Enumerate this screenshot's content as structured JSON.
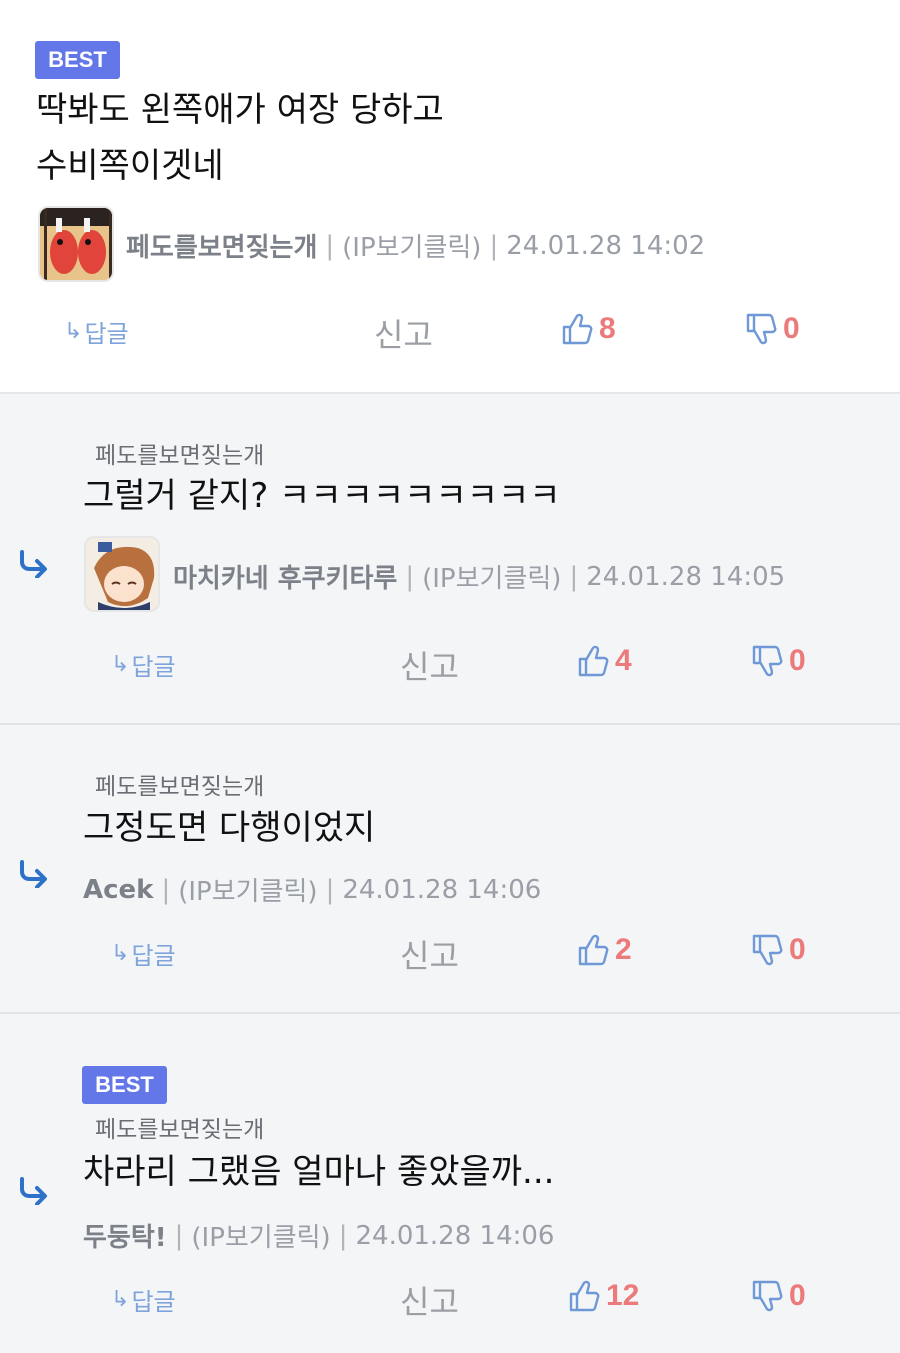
{
  "comments": [
    {
      "badge": "BEST",
      "text_lines": [
        "딱봐도 왼쪽애가 여장 당하고",
        "수비쪽이겟네"
      ],
      "nick": "페도를보면짖는개",
      "ip": "(IP보기클릭)",
      "date": "24.01.28 14:02",
      "reply_label": "답글",
      "report_label": "신고",
      "likes": "8",
      "dislikes": "0"
    },
    {
      "reply_to": "페도를보면짖는개",
      "text": "그럴거 같지? ㅋㅋㅋㅋㅋㅋㅋㅋㅋ",
      "nick": "마치카네 후쿠키타루",
      "ip": "(IP보기클릭)",
      "date": "24.01.28 14:05",
      "reply_label": "답글",
      "report_label": "신고",
      "likes": "4",
      "dislikes": "0"
    },
    {
      "reply_to": "페도를보면짖는개",
      "text": "그정도면 다행이었지",
      "nick": "Acek",
      "ip": "(IP보기클릭)",
      "date": "24.01.28 14:06",
      "reply_label": "답글",
      "report_label": "신고",
      "likes": "2",
      "dislikes": "0"
    },
    {
      "badge": "BEST",
      "reply_to": "페도를보면짖는개",
      "text": "차라리 그랬음 얼마나 좋았을까...",
      "nick": "두둥탁!",
      "ip": "(IP보기클릭)",
      "date": "24.01.28 14:06",
      "reply_label": "답글",
      "report_label": "신고",
      "likes": "12",
      "dislikes": "0"
    }
  ],
  "icons": {
    "reply": "reply-arrow-icon",
    "like": "thumbs-up-icon",
    "dislike": "thumbs-down-icon",
    "nested": "nested-reply-arrow-icon"
  },
  "colors": {
    "best_badge": "#6477e8",
    "vote_count": "#ec7a7a",
    "icon_blue": "#6f98d6",
    "nested_arrow": "#2d72c8",
    "reply_bg": "#f4f5f7"
  }
}
